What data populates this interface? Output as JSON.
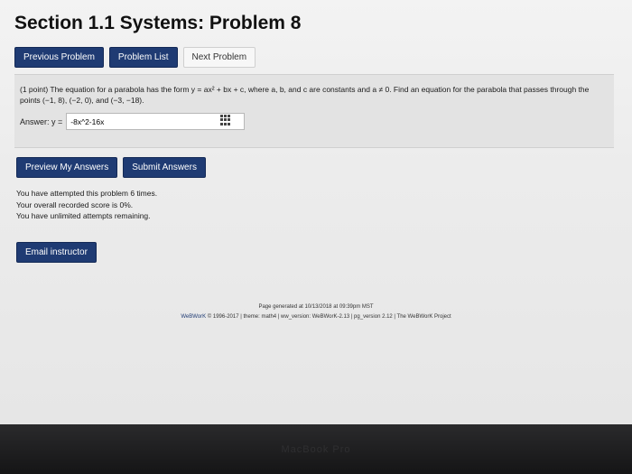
{
  "page": {
    "title": "Section 1.1 Systems: Problem 8"
  },
  "nav": {
    "previous": "Previous Problem",
    "list": "Problem List",
    "next": "Next Problem"
  },
  "problem": {
    "text": "(1 point) The equation for a parabola has the form y = ax² + bx + c, where a, b, and c are constants and a ≠ 0. Find an equation for the parabola that passes through the points (−1, 8), (−2, 0), and (−3, −18).",
    "answer_label": "Answer: y =",
    "answer_value": "-8x^2-16x"
  },
  "actions": {
    "preview": "Preview My Answers",
    "submit": "Submit Answers"
  },
  "status": {
    "attempts": "You have attempted this problem 6 times.",
    "score": "Your overall recorded score is 0%.",
    "remaining": "You have unlimited attempts remaining."
  },
  "email": {
    "label": "Email instructor"
  },
  "footer": {
    "generated": "Page generated at 10/13/2018 at 09:39pm MST",
    "brand": "WeBWorK",
    "copyright": " © 1996-2017 | theme: math4 | ww_version: WeBWorK-2.13 | pg_version 2.12 | The WeBWorK Project"
  },
  "device": {
    "label": "MacBook Pro"
  }
}
